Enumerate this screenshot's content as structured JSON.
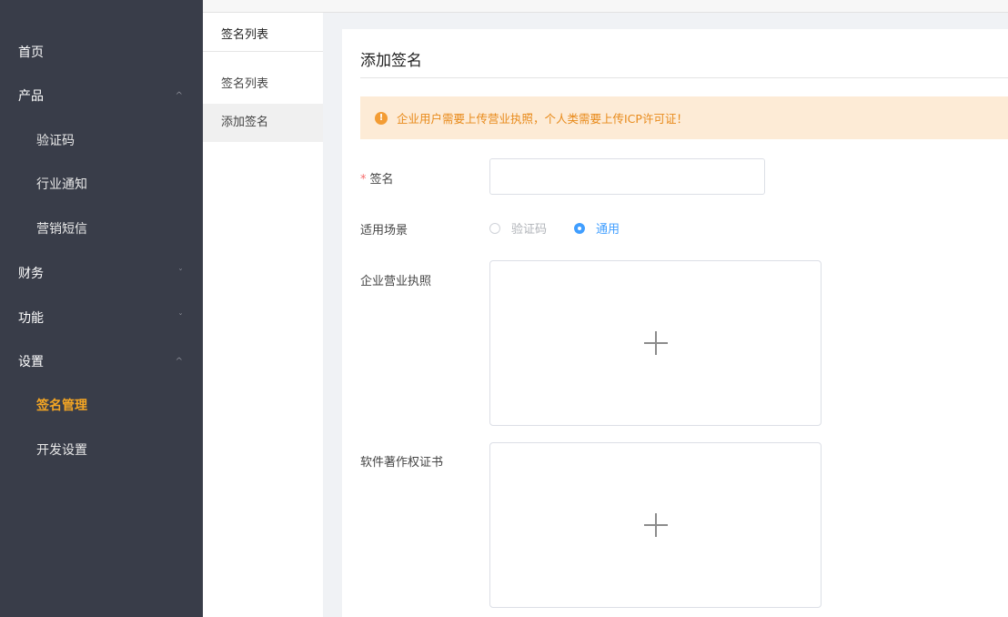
{
  "sidebar": {
    "items": [
      {
        "label": "首页",
        "type": "top"
      },
      {
        "label": "产品",
        "type": "top",
        "chevron": "^"
      },
      {
        "label": "验证码",
        "type": "sub"
      },
      {
        "label": "行业通知",
        "type": "sub"
      },
      {
        "label": "营销短信",
        "type": "sub"
      },
      {
        "label": "财务",
        "type": "top",
        "chevron": "ˇ"
      },
      {
        "label": "功能",
        "type": "top",
        "chevron": "ˇ"
      },
      {
        "label": "设置",
        "type": "top",
        "chevron": "^"
      },
      {
        "label": "签名管理",
        "type": "sub",
        "active": true
      },
      {
        "label": "开发设置",
        "type": "sub"
      }
    ],
    "accent_color": "#f5a623"
  },
  "subpanel": {
    "title": "签名列表",
    "links": [
      {
        "label": "签名列表"
      },
      {
        "label": "添加签名",
        "selected": true
      }
    ]
  },
  "main": {
    "title": "添加签名",
    "alert": {
      "icon": "warning-circle-icon",
      "icon_glyph": "!",
      "text": "企业用户需要上传营业执照，个人类需要上传ICP许可证！",
      "color": "#f39c34"
    },
    "form": {
      "signature_label": "签名",
      "signature_required_mark": "*",
      "signature_value": "",
      "scene_label": "适用场景",
      "scene_options": [
        {
          "label": "验证码",
          "disabled": true,
          "checked": false
        },
        {
          "label": "通用",
          "disabled": false,
          "checked": true
        }
      ],
      "license_label": "企业营业执照",
      "copyright_label": "软件著作权证书"
    }
  }
}
